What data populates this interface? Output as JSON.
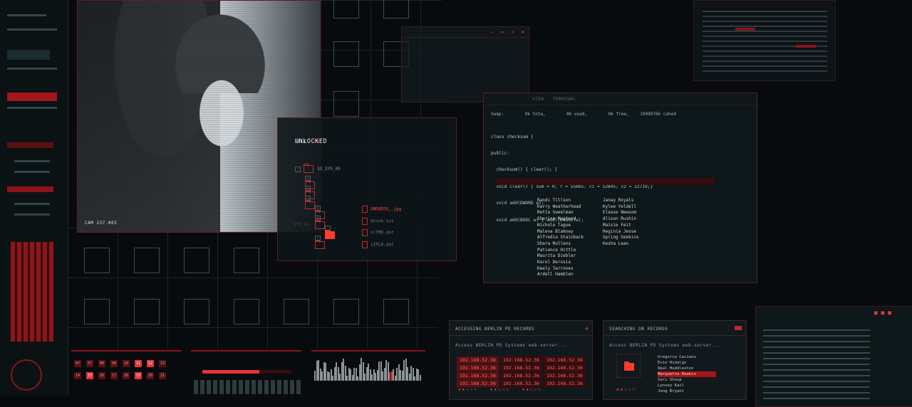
{
  "file_window": {
    "label_prefix": "FILE",
    "label_suffix": "007",
    "status": "UNLOCKED",
    "root_folder": "SI_SYS_05",
    "side_label": "SYS_12",
    "files": [
      "UNDOD3S_.jpg",
      "dtcnk.txt",
      "nlfMD.dat",
      "sIPLR.dat"
    ]
  },
  "video_window": {
    "caption": "CAM 237.002"
  },
  "terminal": {
    "tab_view": "VIEW",
    "tab_terminal": "TERMINAL",
    "swap_line": [
      "Swap:",
      "0k tota,",
      "0k used,",
      "0k free,",
      "1099976k cahed"
    ],
    "code_lines": [
      "class checksum {",
      "public:",
      "  checksum() { clear(); }",
      "  void clear() { sum = 0; r = 55665; c1 = 52845; c2 = 22719;}",
      "  void add(DWORD w);",
      "  void add(BOOL w) { add((DWORD)w);"
    ],
    "names_col1": [
      "Randi Tillson",
      "Karry Weatherhead",
      "Retta Sweelman",
      "Sherice Mustard",
      "Nichole Tague",
      "Malena Blakney",
      "Alfredia Stainback",
      "Shara Mullens",
      "Patience Hittle",
      "Maurita Diebler",
      "Karol Derosia",
      "Keely Terrones",
      "Ardell Hamblen"
    ],
    "names_col2": [
      "Janay Royals",
      "Kylee Yeldell",
      "Elease Newsom",
      "Alison Rushin",
      "Maisie Feit",
      "Reginia Jesse",
      "Spring Seekins",
      "Kesha Lean"
    ]
  },
  "berlin_panel": {
    "title": "ACCESSING BERLIN PD RECORDS",
    "subtitle": "Access BERLIN PD Systems web-server...",
    "ips": [
      "192.168.52.36",
      "192.168.52.36",
      "192.168.52.36",
      "192.168.52.36"
    ]
  },
  "search_panel": {
    "title": "SEARCHING DB RECORDS",
    "subtitle": "Access BERLIN PD Systems web-server...",
    "names": [
      "Gregoria Caciano",
      "Evie Hidalgo",
      "Opal Huddleston",
      "Marquetta Deakin",
      "Sari Shoup",
      "Lynsey Kail",
      "Jung Bryant"
    ],
    "highlight_index": 3
  },
  "window_controls": {
    "minimize": "–",
    "maximize": "▭",
    "close": "✕"
  },
  "keypad": {
    "keys": [
      "07",
      "07",
      "08",
      "09",
      "10",
      "11",
      "12",
      "13",
      "14",
      "15",
      "16",
      "17",
      "18",
      "19",
      "20",
      "21"
    ],
    "active": [
      5,
      6,
      9,
      13
    ]
  },
  "colors": {
    "accent": "#e2363b",
    "background": "#070b0d",
    "panel_border": "#6a1c22"
  }
}
